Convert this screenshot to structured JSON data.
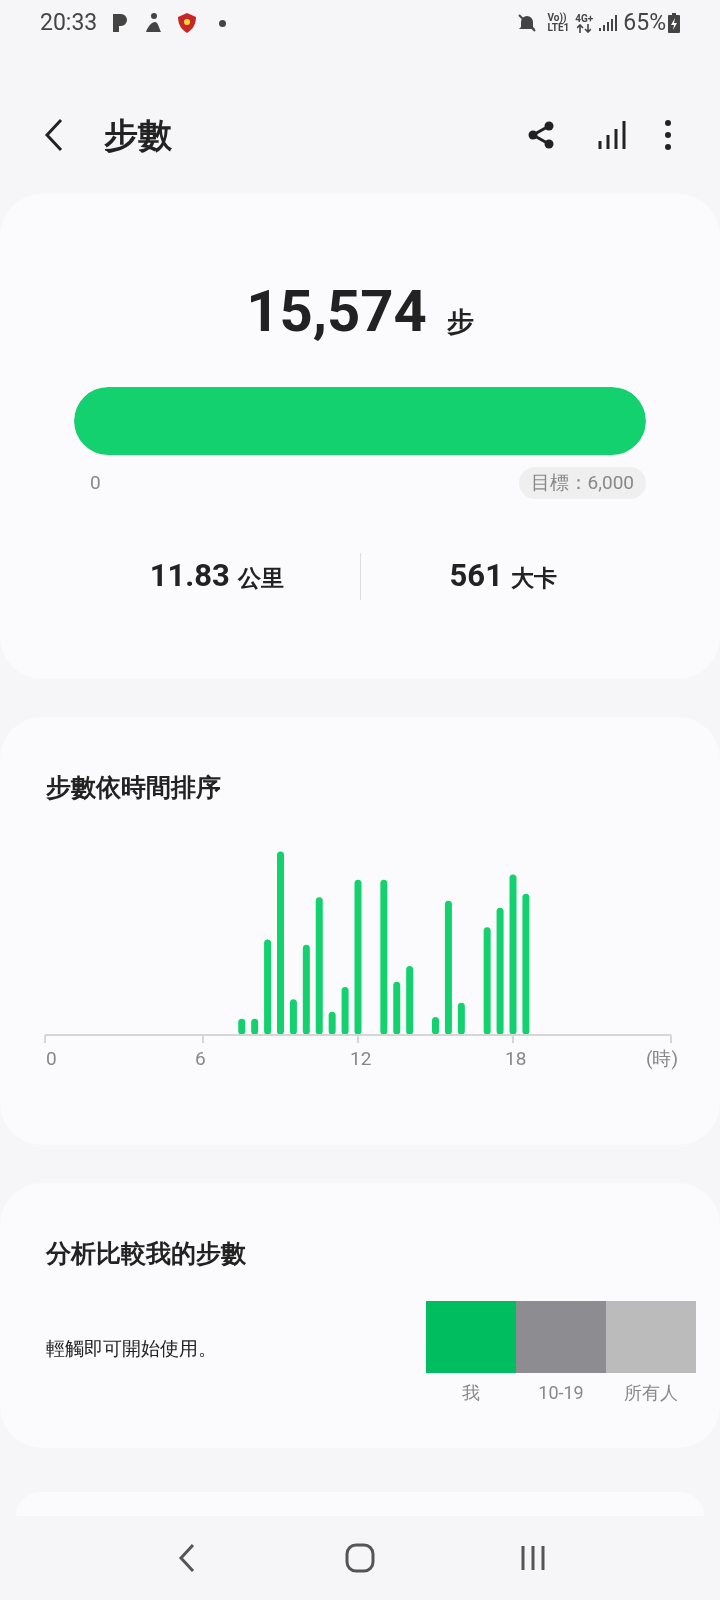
{
  "status_bar": {
    "time": "20:33",
    "network_top": "Vo))",
    "network_bottom": "LTE1",
    "data_type": "4G+",
    "battery": "65%"
  },
  "header": {
    "title": "步數"
  },
  "summary": {
    "steps": "15,574",
    "steps_unit": "步",
    "progress": {
      "level": 1,
      "start": "0",
      "goal": "目標：6,000"
    },
    "stats": [
      {
        "value": "11.83",
        "unit": "公里"
      },
      {
        "value": "561",
        "unit": "大卡"
      }
    ]
  },
  "hourly": {
    "title": "步數依時間排序",
    "x_labels": [
      "0",
      "6",
      "12",
      "18"
    ],
    "unit_label": "(時)"
  },
  "compare": {
    "title": "分析比較我的步數",
    "hint": "輕觸即可開始使用。",
    "groups": [
      {
        "label": "我",
        "color": "#00bd5f"
      },
      {
        "label": "10-19",
        "color": "#8d8c91"
      },
      {
        "label": "所有人",
        "color": "#bbbbbb"
      }
    ]
  }
}
